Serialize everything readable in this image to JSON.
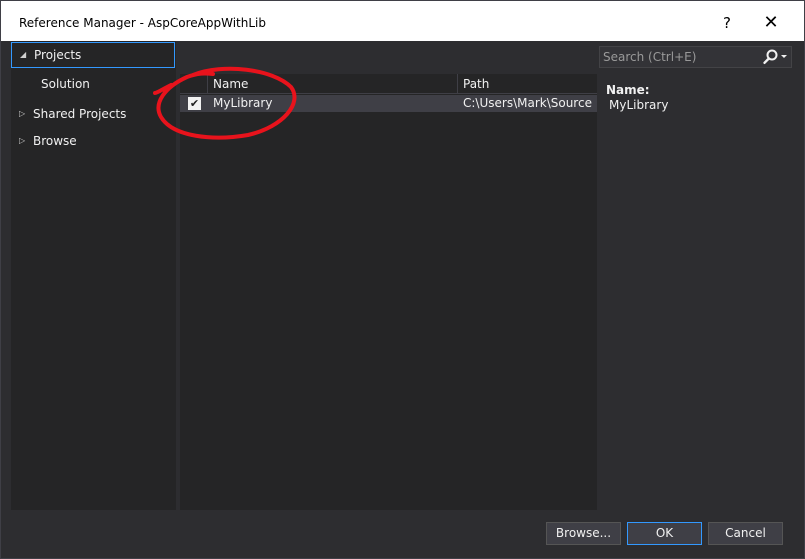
{
  "window": {
    "title": "Reference Manager - AspCoreAppWithLib",
    "help_label": "?",
    "close_label": "✕"
  },
  "sidebar": {
    "items": [
      {
        "label": "Projects",
        "arrow": "◢",
        "selected": true
      },
      {
        "label": "Solution"
      },
      {
        "label": "Shared Projects",
        "arrow": "▷"
      },
      {
        "label": "Browse",
        "arrow": "▷"
      }
    ]
  },
  "grid": {
    "columns": [
      "Name",
      "Path"
    ],
    "rows": [
      {
        "checked": true,
        "check_glyph": "✔",
        "name": "MyLibrary",
        "path": "C:\\Users\\Mark\\Source..."
      }
    ]
  },
  "search": {
    "placeholder": "Search (Ctrl+E)",
    "icon": "search-icon"
  },
  "details": {
    "name_label": "Name:",
    "name_value": "MyLibrary"
  },
  "buttons": {
    "browse": "Browse...",
    "ok": "OK",
    "cancel": "Cancel"
  },
  "colors": {
    "background": "#2d2d30",
    "panel": "#252526",
    "accent": "#3399ff",
    "annotation": "#e8131c"
  }
}
